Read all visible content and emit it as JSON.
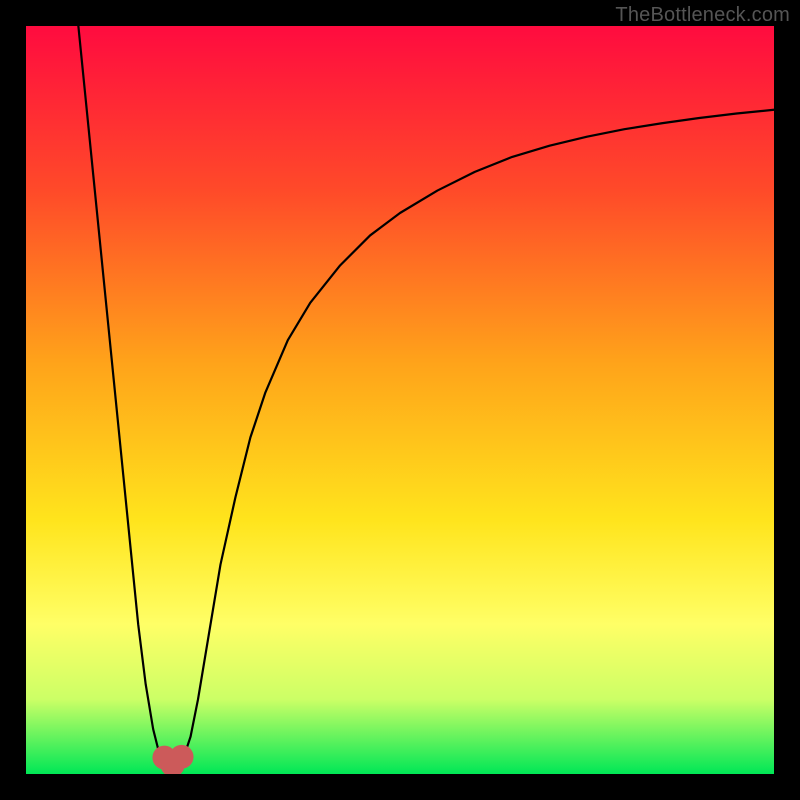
{
  "watermark": "TheBottleneck.com",
  "chart_data": {
    "type": "line",
    "title": "",
    "xlabel": "",
    "ylabel": "",
    "xlim": [
      0,
      100
    ],
    "ylim": [
      0,
      100
    ],
    "grid": false,
    "legend": false,
    "background_gradient": {
      "stops": [
        {
          "offset": 0.0,
          "color": "#ff0b3f"
        },
        {
          "offset": 0.22,
          "color": "#ff4a29"
        },
        {
          "offset": 0.45,
          "color": "#ffa31a"
        },
        {
          "offset": 0.66,
          "color": "#ffe41c"
        },
        {
          "offset": 0.8,
          "color": "#ffff66"
        },
        {
          "offset": 0.9,
          "color": "#ccff66"
        },
        {
          "offset": 1.0,
          "color": "#00e756"
        }
      ]
    },
    "series": [
      {
        "name": "bottleneck-curve",
        "color": "#000000",
        "width": 2.2,
        "x": [
          7,
          8,
          9,
          10,
          11,
          12,
          13,
          14,
          15,
          16,
          17,
          18,
          19,
          20,
          21,
          22,
          23,
          24,
          25,
          26,
          28,
          30,
          32,
          35,
          38,
          42,
          46,
          50,
          55,
          60,
          65,
          70,
          75,
          80,
          85,
          90,
          95,
          100
        ],
        "y": [
          100,
          90,
          80,
          70,
          60,
          50,
          40,
          30,
          20,
          12,
          6,
          2,
          1,
          1,
          2,
          5,
          10,
          16,
          22,
          28,
          37,
          45,
          51,
          58,
          63,
          68,
          72,
          75,
          78,
          80.5,
          82.5,
          84,
          85.2,
          86.2,
          87,
          87.7,
          88.3,
          88.8
        ]
      }
    ],
    "markers": [
      {
        "name": "valley-left",
        "x": 18.5,
        "y": 2.2,
        "r": 1.6,
        "color": "#cc5a5a"
      },
      {
        "name": "valley-mid",
        "x": 19.6,
        "y": 1.2,
        "r": 1.6,
        "color": "#cc5a5a"
      },
      {
        "name": "valley-right",
        "x": 20.8,
        "y": 2.3,
        "r": 1.6,
        "color": "#cc5a5a"
      }
    ],
    "valley_stroke": {
      "color": "#cc5a5a",
      "width": 10,
      "x": [
        18.2,
        18.8,
        19.4,
        20.0,
        20.6,
        21.2
      ],
      "y": [
        3.0,
        1.6,
        1.0,
        1.0,
        1.7,
        3.1
      ]
    }
  }
}
